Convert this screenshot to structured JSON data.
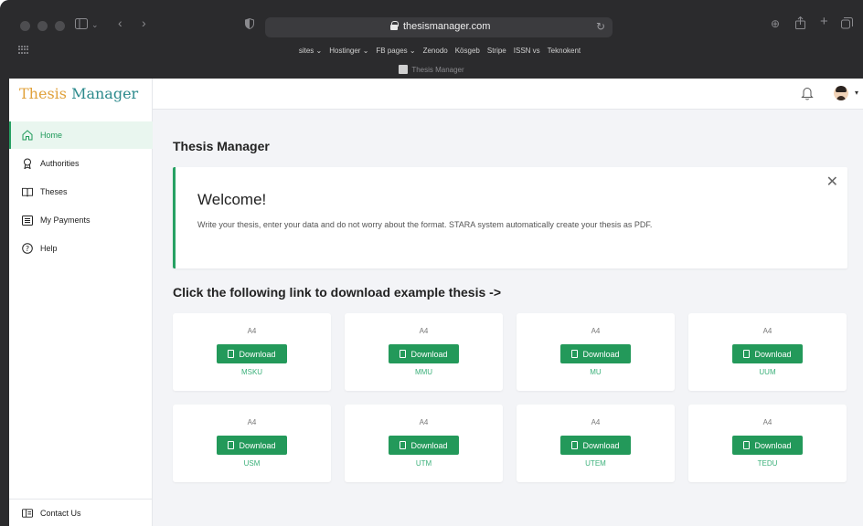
{
  "browser": {
    "url": "thesismanager.com",
    "bookmarks": [
      "sites ⌄",
      "Hostinger ⌄",
      "FB pages ⌄",
      "Zenodo",
      "Kösgeb",
      "Stripe",
      "ISSN vs",
      "Teknokent"
    ],
    "tab_title": "Thesis Manager"
  },
  "brand": {
    "part1": "Thesis",
    "part2": "Manager"
  },
  "sidebar": {
    "items": [
      {
        "label": "Home",
        "icon": "home-icon",
        "active": true
      },
      {
        "label": "Authorities",
        "icon": "badge-icon"
      },
      {
        "label": "Theses",
        "icon": "book-icon"
      },
      {
        "label": "My Payments",
        "icon": "list-icon"
      },
      {
        "label": "Help",
        "icon": "help-icon"
      }
    ],
    "contact": "Contact Us"
  },
  "main": {
    "title": "Thesis Manager",
    "welcome": {
      "title": "Welcome!",
      "text": "Write your thesis, enter your data and do not worry about the format. STARA system automatically create your thesis as PDF."
    },
    "section_title": "Click the following link to download example thesis ->",
    "cards": [
      {
        "size": "A4",
        "button": "Download",
        "uni": "MSKU"
      },
      {
        "size": "A4",
        "button": "Download",
        "uni": "MMU"
      },
      {
        "size": "A4",
        "button": "Download",
        "uni": "MU"
      },
      {
        "size": "A4",
        "button": "Download",
        "uni": "UUM"
      },
      {
        "size": "A4",
        "button": "Download",
        "uni": "USM"
      },
      {
        "size": "A4",
        "button": "Download",
        "uni": "UTM"
      },
      {
        "size": "A4",
        "button": "Download",
        "uni": "UTEM"
      },
      {
        "size": "A4",
        "button": "Download",
        "uni": "TEDU"
      }
    ]
  },
  "colors": {
    "accent": "#23995a",
    "brand_orange": "#e0a13a",
    "brand_teal": "#2c8a8c"
  }
}
